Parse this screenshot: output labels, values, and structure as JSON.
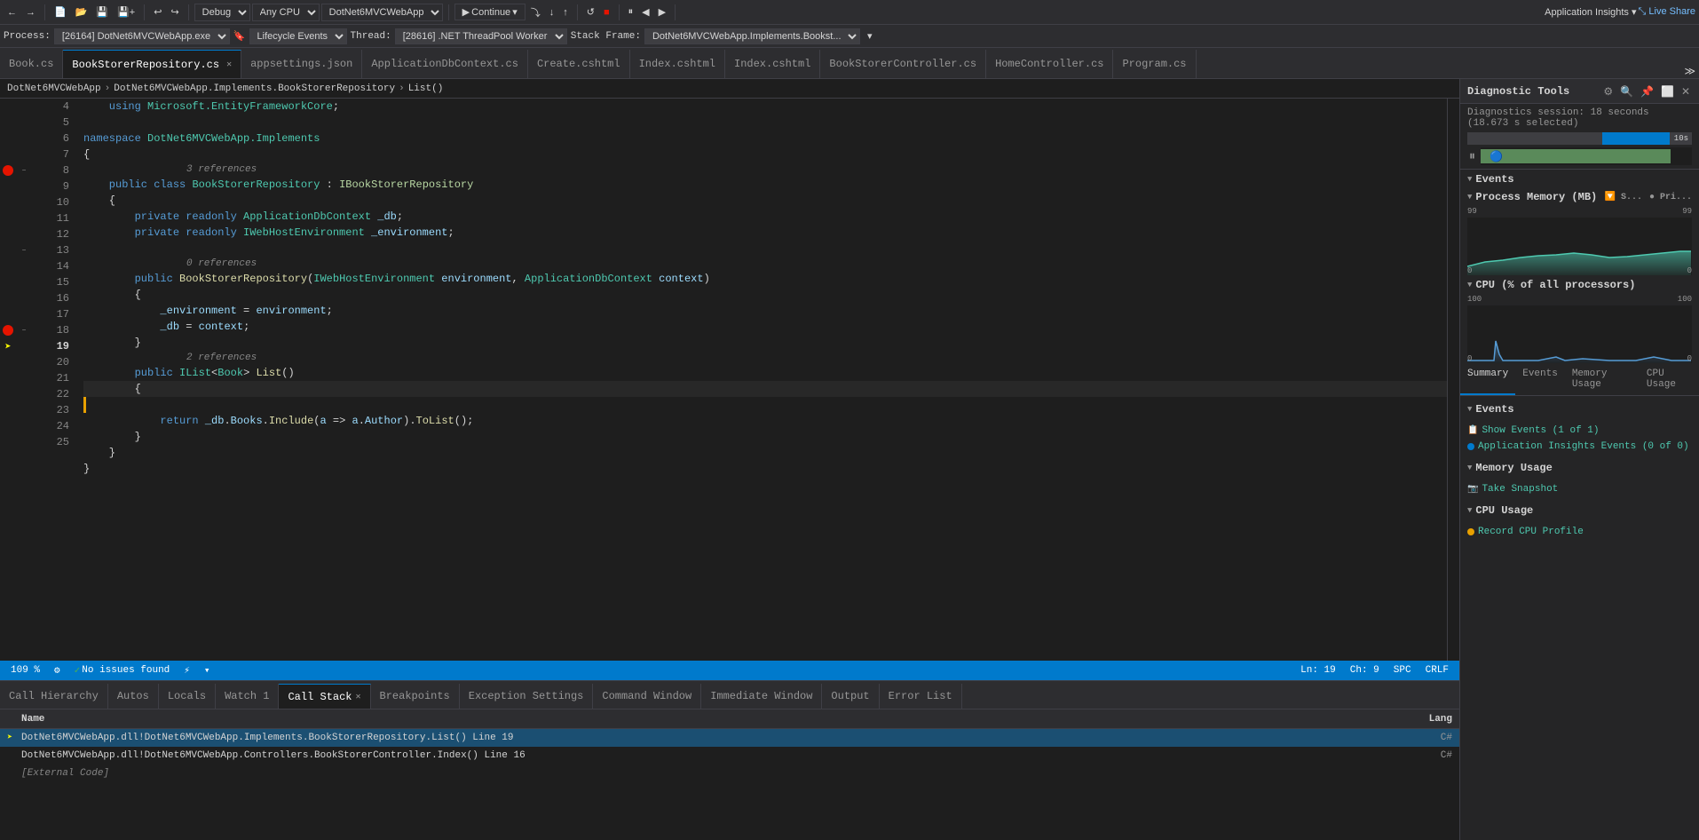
{
  "toolbar": {
    "debug_label": "Debug",
    "cpu_label": "Any CPU",
    "project_label": "DotNet6MVCWebApp",
    "continue_label": "Continue",
    "app_insights_label": "Application Insights",
    "live_share_label": "Live Share"
  },
  "process_bar": {
    "process_label": "Process:",
    "process_value": "[26164] DotNet6MVCWebApp.exe",
    "lifecycle_label": "Lifecycle Events",
    "thread_label": "Thread:",
    "thread_value": "[28616] .NET ThreadPool Worker",
    "stack_frame_label": "Stack Frame:",
    "stack_frame_value": "DotNet6MVCWebApp.Implements.Bookst..."
  },
  "tabs": [
    {
      "id": "book-cs",
      "label": "Book.cs",
      "active": false,
      "closeable": false
    },
    {
      "id": "bookstorerep",
      "label": "BookStorerRepository.cs",
      "active": true,
      "closeable": true
    },
    {
      "id": "appsettings",
      "label": "appsettings.json",
      "active": false,
      "closeable": false
    },
    {
      "id": "applicationdb",
      "label": "ApplicationDbContext.cs",
      "active": false,
      "closeable": false
    },
    {
      "id": "create",
      "label": "Create.cshtml",
      "active": false,
      "closeable": false
    },
    {
      "id": "index1",
      "label": "Index.cshtml",
      "active": false,
      "closeable": false
    },
    {
      "id": "index2",
      "label": "Index.cshtml",
      "active": false,
      "closeable": false
    },
    {
      "id": "bookstorercontroller",
      "label": "BookStorerController.cs",
      "active": false,
      "closeable": false
    },
    {
      "id": "homecontroller",
      "label": "HomeController.cs",
      "active": false,
      "closeable": false
    },
    {
      "id": "program",
      "label": "Program.cs",
      "active": false,
      "closeable": false
    }
  ],
  "breadcrumb": {
    "project": "DotNet6MVCWebApp",
    "namespace": "DotNet6MVCWebApp.Implements.BookStorerRepository",
    "method": "List()"
  },
  "code_lines": [
    {
      "num": 4,
      "indent": 0,
      "gutter": "",
      "content": "    using Microsoft.EntityFrameworkCore;"
    },
    {
      "num": 5,
      "indent": 0,
      "gutter": "",
      "content": ""
    },
    {
      "num": 6,
      "indent": 0,
      "gutter": "",
      "content": "namespace DotNet6MVCWebApp.Implements"
    },
    {
      "num": 7,
      "indent": 0,
      "gutter": "",
      "content": "{"
    },
    {
      "num": 8,
      "indent": 1,
      "gutter": "bp",
      "content": "    public class BookStorerRepository : IBookStorerRepository"
    },
    {
      "num": 9,
      "indent": 2,
      "gutter": "",
      "content": "    {"
    },
    {
      "num": 10,
      "indent": 2,
      "gutter": "",
      "content": "        private readonly ApplicationDbContext _db;"
    },
    {
      "num": 11,
      "indent": 2,
      "gutter": "",
      "content": "        private readonly IWebHostEnvironment _environment;"
    },
    {
      "num": 12,
      "indent": 2,
      "gutter": "",
      "content": ""
    },
    {
      "num": 13,
      "indent": 2,
      "gutter": "collapse",
      "content": "        public BookStorerRepository(IWebHostEnvironment environment, ApplicationDbContext context)"
    },
    {
      "num": 14,
      "indent": 2,
      "gutter": "",
      "content": "        {"
    },
    {
      "num": 15,
      "indent": 2,
      "gutter": "",
      "content": "            _environment = environment;"
    },
    {
      "num": 16,
      "indent": 2,
      "gutter": "",
      "content": "            _db = context;"
    },
    {
      "num": 17,
      "indent": 2,
      "gutter": "",
      "content": "        }"
    },
    {
      "num": 18,
      "indent": 2,
      "gutter": "bp",
      "content": "        public IList<Book> List()"
    },
    {
      "num": 19,
      "indent": 2,
      "gutter": "arrow",
      "content": "        {"
    },
    {
      "num": 20,
      "indent": 2,
      "gutter": "yellow",
      "content": ""
    },
    {
      "num": 21,
      "indent": 2,
      "gutter": "",
      "content": "            return _db.Books.Include(a => a.Author).ToList();"
    },
    {
      "num": 22,
      "indent": 2,
      "gutter": "",
      "content": "        }"
    },
    {
      "num": 23,
      "indent": 1,
      "gutter": "",
      "content": "    }"
    },
    {
      "num": 24,
      "indent": 0,
      "gutter": "",
      "content": "}"
    },
    {
      "num": 25,
      "indent": 0,
      "gutter": "",
      "content": ""
    }
  ],
  "status_bar": {
    "zoom": "109 %",
    "no_issues": "No issues found",
    "ln": "Ln: 19",
    "ch": "Ch: 9",
    "spc": "SPC",
    "crlf": "CRLF"
  },
  "bottom_tabs": [
    {
      "id": "call-hierarchy",
      "label": "Call Hierarchy",
      "active": false,
      "closeable": false
    },
    {
      "id": "autos",
      "label": "Autos",
      "active": false,
      "closeable": false
    },
    {
      "id": "locals",
      "label": "Locals",
      "active": false,
      "closeable": false
    },
    {
      "id": "watch",
      "label": "Watch 1",
      "active": false,
      "closeable": false
    },
    {
      "id": "call-stack",
      "label": "Call Stack",
      "active": true,
      "closeable": true
    },
    {
      "id": "breakpoints",
      "label": "Breakpoints",
      "active": false,
      "closeable": false
    },
    {
      "id": "exception-settings",
      "label": "Exception Settings",
      "active": false,
      "closeable": false
    },
    {
      "id": "command-window",
      "label": "Command Window",
      "active": false,
      "closeable": false
    },
    {
      "id": "immediate-window",
      "label": "Immediate Window",
      "active": false,
      "closeable": false
    },
    {
      "id": "output",
      "label": "Output",
      "active": false,
      "closeable": false
    },
    {
      "id": "error-list",
      "label": "Error List",
      "active": false,
      "closeable": false
    }
  ],
  "call_stack": {
    "col_name": "Name",
    "col_lang": "Lang",
    "rows": [
      {
        "id": 1,
        "name": "DotNet6MVCWebApp.dll!DotNet6MVCWebApp.Implements.BookStorerRepository.List() Line 19",
        "lang": "C#",
        "active": true
      },
      {
        "id": 2,
        "name": "DotNet6MVCWebApp.dll!DotNet6MVCWebApp.Controllers.BookStorerController.Index() Line 16",
        "lang": "C#",
        "active": false
      },
      {
        "id": 3,
        "name": "[External Code]",
        "lang": "",
        "active": false,
        "external": true
      }
    ]
  },
  "diagnostics": {
    "panel_title": "Diagnostic Tools",
    "session_label": "Diagnostics session: 18 seconds (18.673 s selected)",
    "time_label": "10s",
    "events_label": "Events",
    "process_memory_label": "Process Memory (MB)",
    "memory_max": "99",
    "memory_min": "0",
    "cpu_label": "CPU (% of all processors)",
    "cpu_max": "100",
    "cpu_min": "0",
    "tabs": [
      {
        "id": "summary",
        "label": "Summary",
        "active": true
      },
      {
        "id": "events",
        "label": "Events",
        "active": false
      },
      {
        "id": "memory-usage",
        "label": "Memory Usage",
        "active": false
      },
      {
        "id": "cpu-usage",
        "label": "CPU Usage",
        "active": false
      }
    ],
    "events_section_label": "Events",
    "show_events_label": "Show Events (1 of 1)",
    "app_insights_events_label": "Application Insights Events (0 of 0)",
    "memory_usage_section_label": "Memory Usage",
    "take_snapshot_label": "Take Snapshot",
    "cpu_usage_section_label": "CPU Usage",
    "record_cpu_label": "Record CPU Profile",
    "filter_label": "S...",
    "pri_label": "Pri..."
  }
}
